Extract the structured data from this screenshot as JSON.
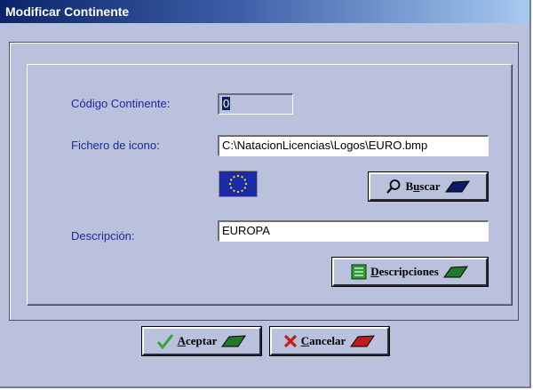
{
  "window": {
    "title": "Modificar Continente"
  },
  "form": {
    "code_label": "Código Continente:",
    "code_value": "0",
    "icon_file_label": "Fichero de icono:",
    "icon_file_value": "C:\\NatacionLicencias\\Logos\\EURO.bmp",
    "description_label": "Descripción:",
    "description_value": "EUROPA"
  },
  "buttons": {
    "search_prefix": "B",
    "search_underline": "u",
    "search_rest": "scar",
    "descriptions_underline": "D",
    "descriptions_rest": "escripciones",
    "accept_underline": "A",
    "accept_rest": "ceptar",
    "cancel_underline": "C",
    "cancel_rest": "ancelar"
  },
  "icons": {
    "flag": "eu-flag-icon",
    "search": "magnifier-icon",
    "descriptions": "list-icon",
    "accept": "checkmark-icon",
    "cancel": "x-icon"
  },
  "colors": {
    "window_bg": "#b9c1dc",
    "label_text": "#1a2a9a",
    "accent_green": "#1f7a2a",
    "accent_red": "#c41a1a",
    "title_bar": "#0a246a"
  }
}
